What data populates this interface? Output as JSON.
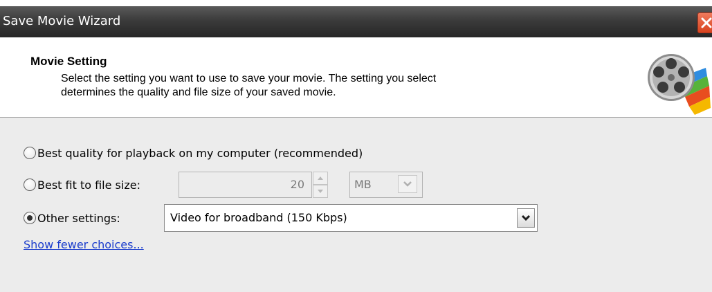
{
  "window": {
    "title": "Save Movie Wizard",
    "close_icon": "close-icon"
  },
  "header": {
    "title": "Movie Setting",
    "description_line1": "Select the setting you want to use to save your movie. The setting you select",
    "description_line2": "determines the quality and file size of your saved movie.",
    "icon": "movie-film-reel-icon"
  },
  "options": {
    "best_quality": {
      "label": "Best quality for playback on my computer (recommended)",
      "checked": false
    },
    "best_fit": {
      "label": "Best fit to file size:",
      "checked": false,
      "size_value": "20",
      "unit_value": "MB",
      "enabled": false
    },
    "other_settings": {
      "label": "Other settings:",
      "checked": true,
      "selected_value": "Video for broadband (150 Kbps)"
    }
  },
  "link": {
    "label": "Show fewer choices..."
  },
  "colors": {
    "titlebar": "#3b3b3b",
    "close_button": "#d8431e",
    "body_background": "#ececec",
    "link": "#1a3ccc"
  }
}
